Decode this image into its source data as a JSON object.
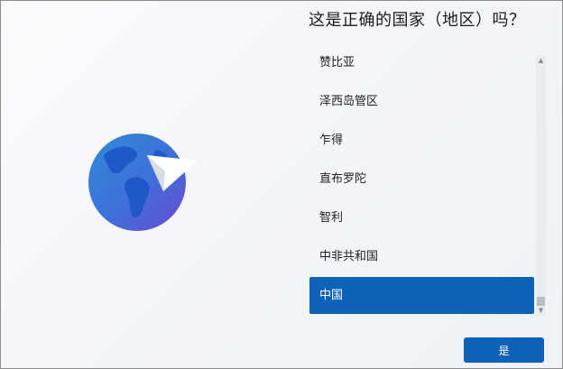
{
  "heading": "这是正确的国家（地区）吗？",
  "countries": [
    "赞比亚",
    "泽西岛管区",
    "乍得",
    "直布罗陀",
    "智利",
    "中非共和国",
    "中国"
  ],
  "selected_country": "中国",
  "scroll": {
    "up_arrow": "▲",
    "down_arrow": "▼"
  },
  "next_button_label": "是",
  "colors": {
    "accent": "#0e62b7",
    "globe_light": "#2f8bd8",
    "globe_dark": "#6a4bd0",
    "land": "#1a55c4"
  },
  "icons": {
    "illustration": "globe-paper-plane-icon"
  }
}
